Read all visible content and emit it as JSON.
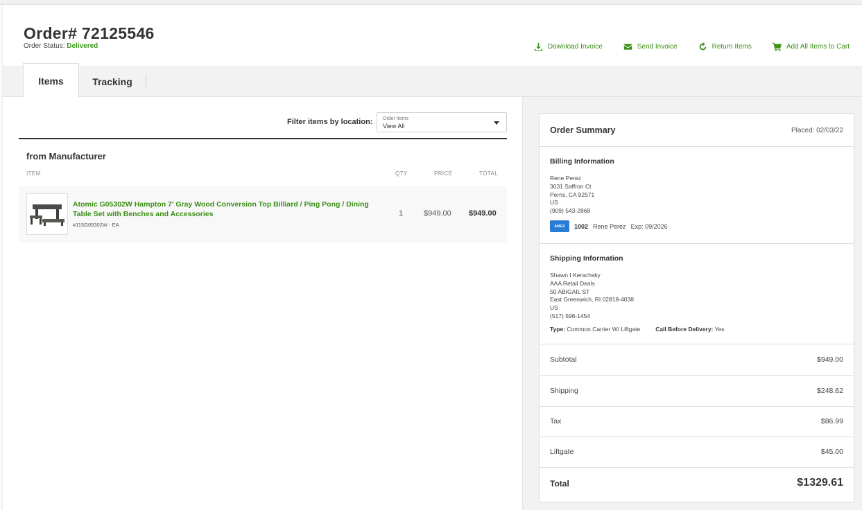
{
  "order": {
    "title": "Order# 72125546",
    "status_label": "Order Status:",
    "status_value": "Delivered"
  },
  "actions": {
    "download_invoice": "Download Invoice",
    "send_invoice": "Send Invoice",
    "return_items": "Return Items",
    "add_all_to_cart": "Add All Items to Cart"
  },
  "tabs": {
    "items": "Items",
    "tracking": "Tracking"
  },
  "filter": {
    "label": "Filter items by location:",
    "select_caption": "Order Items",
    "select_value": "View All"
  },
  "items_section": {
    "title": "from Manufacturer",
    "columns": {
      "item": "ITEM",
      "qty": "QTY",
      "price": "PRICE",
      "total": "TOTAL"
    },
    "rows": [
      {
        "name": "Atomic G05302W Hampton 7' Gray Wood Conversion Top Billiard / Ping Pong / Dining Table Set with Benches and Accessories",
        "sku": "#115G05302W - EA",
        "qty": "1",
        "price": "$949.00",
        "total": "$949.00"
      }
    ]
  },
  "summary": {
    "title": "Order Summary",
    "placed": "Placed: 02/03/22",
    "billing": {
      "title": "Billing Information",
      "lines": [
        "Rene Perez",
        "3031 Saffron Ct",
        "Perris, CA 92571",
        "US",
        "(909) 543-2868"
      ],
      "card_brand": "AMEX",
      "card_last4": "1002",
      "card_name": "Rene Perez",
      "card_exp": "Exp: 09/2026"
    },
    "shipping": {
      "title": "Shipping Information",
      "lines": [
        "Shawn I Kerachsky",
        "AAA Retail Deals",
        "50 ABIGAIL ST",
        "East Greenwich, RI 02818-4038",
        "US",
        "(517) 596-1454"
      ],
      "type_label": "Type:",
      "type_value": "Common Carrier W/ Liftgate",
      "call_label": "Call Before Delivery:",
      "call_value": "Yes"
    },
    "lines": [
      {
        "label": "Subtotal",
        "amount": "$949.00"
      },
      {
        "label": "Shipping",
        "amount": "$248.62"
      },
      {
        "label": "Tax",
        "amount": "$86.99"
      },
      {
        "label": "Liftgate",
        "amount": "$45.00"
      }
    ],
    "total_label": "Total",
    "total_amount": "$1329.61"
  },
  "colors": {
    "accent_green": "#3a8f15",
    "status_green": "#3d9b1a",
    "amex_blue": "#2a7bd4"
  }
}
